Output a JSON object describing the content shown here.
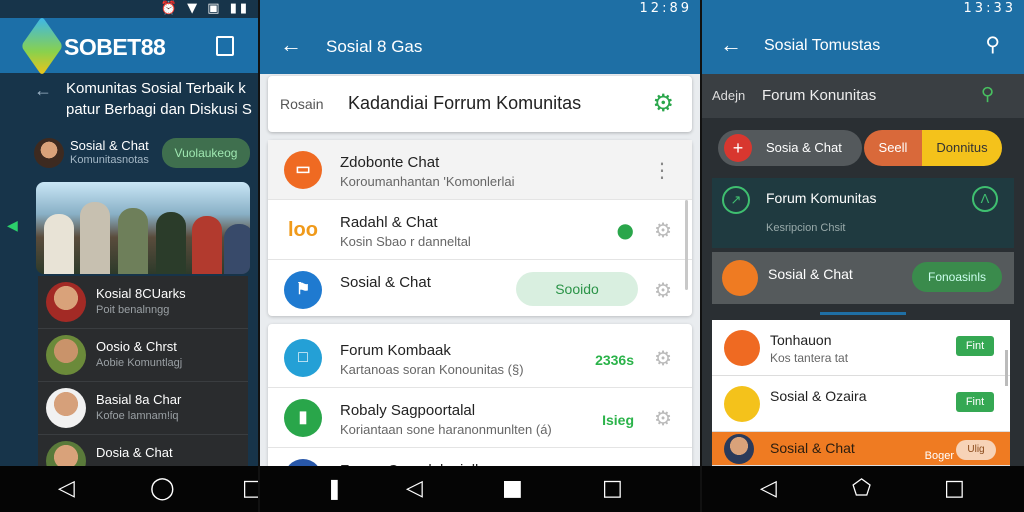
{
  "screen1": {
    "status": {
      "right": "⏰ ▼ ▣ ▮▮"
    },
    "logo_text": "SOBET88",
    "headline": "Komunitas Sosial Terbaik k patur Berbagi dan Diskusi S",
    "user": {
      "title": "Sosial & Chat",
      "sub": "Komunitasnotas",
      "button": "Vuolaukeog"
    },
    "list": [
      {
        "title": "Kosial 8CUarks",
        "sub": "Poit benalnngg"
      },
      {
        "title": "Oosio & Chrst",
        "sub": "Aobie Komuntlagj"
      },
      {
        "title": "Basial 8a Char",
        "sub": "Kofoe lamnam!iq"
      },
      {
        "title": "Dosia & Chat",
        "sub": ""
      }
    ]
  },
  "screen2": {
    "status": {
      "time": "12:89"
    },
    "title": "Sosial 8 Gas",
    "search_label": "Rosain",
    "heading": "Kadandiai Forrum Komunitas",
    "card1": [
      {
        "title": "Zdobonte Chat",
        "sub": "Koroumanhantan 'Komonlerlai",
        "icon_text": "▭",
        "color": "#ef6a22"
      },
      {
        "title": "Radahl & Chat",
        "sub": "Kosin Sbao r danneltal",
        "icon_text": "loo",
        "color": "#ffffff"
      },
      {
        "title": "Sosial & Chat",
        "sub": "",
        "icon_text": "⚑",
        "color": "#1f7ad0",
        "pill": "Sooido"
      }
    ],
    "card2": [
      {
        "title": "Forum Kombaak",
        "sub": "Kartanoas soran Konounitas (§)",
        "count": "2336s",
        "color": "#24a0d6"
      },
      {
        "title": "Robaly Sagpoortalal",
        "sub": "Koriantaan sone haranonmunlten (á)",
        "count": "Isieg",
        "color": "#29a64a"
      },
      {
        "title": "Forum Qamulolanioll",
        "sub": "",
        "count": "",
        "color": "#2857a8"
      }
    ]
  },
  "screen3": {
    "status": {
      "time": "13:33"
    },
    "title": "Sosial Tomustas",
    "sub_a": "Adejn",
    "sub_b": "Forum Konunitas",
    "chipA": "Sosia & Chat",
    "chipB_left": "Seell",
    "chipB_right": "Donnitus",
    "forum_title": "Forum Komunitas",
    "forum_sub": "Kesripcion Chsit",
    "sos_title": "Sosial & Chat",
    "sos_button": "Fonoasinls",
    "rows": [
      {
        "title": "Tonhauon",
        "sub": "Kos tantera tat",
        "badge": "Fint",
        "color": "#ef6a22"
      },
      {
        "title": "Sosial & Ozaira",
        "sub": "",
        "badge": "Fint",
        "color": "#f4c21b"
      },
      {
        "title": "Sosial & Chat",
        "sub": "",
        "extra": "Boger",
        "pill": "Ulig"
      }
    ]
  }
}
